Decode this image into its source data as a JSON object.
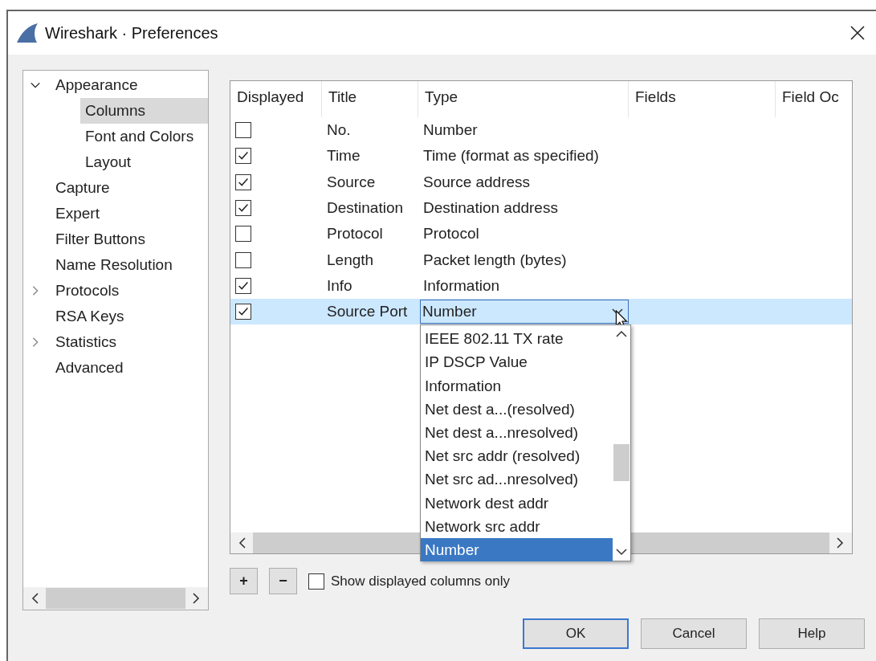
{
  "window": {
    "title": "Wireshark · Preferences"
  },
  "sidebar": {
    "items": [
      {
        "label": "Appearance",
        "kind": "branch",
        "expanded": true,
        "selected": false,
        "children": [
          {
            "label": "Columns",
            "selected": true
          },
          {
            "label": "Font and Colors",
            "selected": false
          },
          {
            "label": "Layout",
            "selected": false
          }
        ]
      },
      {
        "label": "Capture",
        "kind": "leaf",
        "selected": false
      },
      {
        "label": "Expert",
        "kind": "leaf",
        "selected": false
      },
      {
        "label": "Filter Buttons",
        "kind": "leaf",
        "selected": false
      },
      {
        "label": "Name Resolution",
        "kind": "leaf",
        "selected": false
      },
      {
        "label": "Protocols",
        "kind": "branch",
        "expanded": false,
        "selected": false
      },
      {
        "label": "RSA Keys",
        "kind": "leaf",
        "selected": false
      },
      {
        "label": "Statistics",
        "kind": "branch",
        "expanded": false,
        "selected": false
      },
      {
        "label": "Advanced",
        "kind": "leaf",
        "selected": false
      }
    ]
  },
  "columns_table": {
    "columns": [
      "Displayed",
      "Title",
      "Type",
      "Fields",
      "Field Oc"
    ],
    "rows": [
      {
        "displayed": false,
        "title": "No.",
        "type": "Number",
        "selected": false,
        "editing": false
      },
      {
        "displayed": true,
        "title": "Time",
        "type": "Time (format as specified)",
        "selected": false,
        "editing": false
      },
      {
        "displayed": true,
        "title": "Source",
        "type": "Source address",
        "selected": false,
        "editing": false
      },
      {
        "displayed": true,
        "title": "Destination",
        "type": "Destination address",
        "selected": false,
        "editing": false
      },
      {
        "displayed": false,
        "title": "Protocol",
        "type": "Protocol",
        "selected": false,
        "editing": false
      },
      {
        "displayed": false,
        "title": "Length",
        "type": "Packet length (bytes)",
        "selected": false,
        "editing": false
      },
      {
        "displayed": true,
        "title": "Info",
        "type": "Information",
        "selected": false,
        "editing": false
      },
      {
        "displayed": true,
        "title": "Source Port",
        "type": "Number",
        "selected": true,
        "editing": true
      }
    ]
  },
  "type_dropdown": {
    "options": [
      {
        "label": "IEEE 802.11 TX rate",
        "selected": false
      },
      {
        "label": "IP DSCP Value",
        "selected": false
      },
      {
        "label": "Information",
        "selected": false
      },
      {
        "label": "Net dest a...(resolved)",
        "selected": false
      },
      {
        "label": "Net dest a...nresolved)",
        "selected": false
      },
      {
        "label": "Net src addr (resolved)",
        "selected": false
      },
      {
        "label": "Net src ad...nresolved)",
        "selected": false
      },
      {
        "label": "Network dest addr",
        "selected": false
      },
      {
        "label": "Network src addr",
        "selected": false
      },
      {
        "label": "Number",
        "selected": true
      }
    ]
  },
  "toolbar": {
    "add_button": "+",
    "remove_button": "−",
    "show_displayed_only": {
      "label": "Show displayed columns only",
      "checked": false
    }
  },
  "buttons": [
    {
      "label": "OK",
      "default": true
    },
    {
      "label": "Cancel",
      "default": false
    },
    {
      "label": "Help",
      "default": false
    }
  ]
}
